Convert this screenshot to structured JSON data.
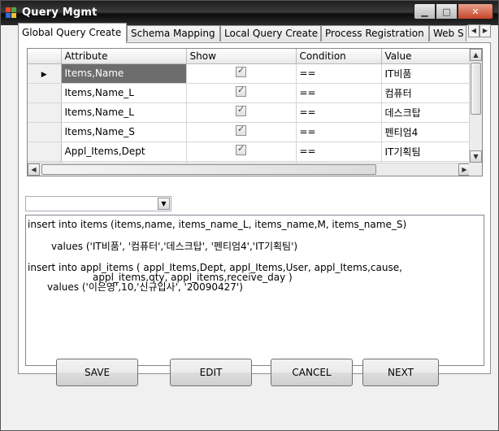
{
  "window": {
    "title": "Query Mgmt"
  },
  "tabs": [
    {
      "label": "Global Query Create",
      "active": true
    },
    {
      "label": "Schema Mapping",
      "active": false
    },
    {
      "label": "Local Query Create",
      "active": false
    },
    {
      "label": "Process Registration",
      "active": false
    },
    {
      "label": "Web S",
      "active": false
    }
  ],
  "grid": {
    "columns": [
      "Attribute",
      "Show",
      "Condition",
      "Value"
    ],
    "rows": [
      {
        "attribute": "Items,Name",
        "show": true,
        "condition": "==",
        "value": "IT비품",
        "current": true
      },
      {
        "attribute": "Items,Name_L",
        "show": true,
        "condition": "==",
        "value": "컴퓨터",
        "current": false
      },
      {
        "attribute": "Items,Name_L",
        "show": true,
        "condition": "==",
        "value": "데스크탑",
        "current": false
      },
      {
        "attribute": "Items,Name_S",
        "show": true,
        "condition": "==",
        "value": "펜티엄4",
        "current": false
      },
      {
        "attribute": "Appl_Items,Dept",
        "show": true,
        "condition": "==",
        "value": "IT기획팀",
        "current": false
      }
    ]
  },
  "combo": {
    "value": ""
  },
  "sql": {
    "line1": "insert into items (items,name, items_name_L, items_name,M, items_name_S)",
    "line2": "values ('IT비품', '컴퓨터','데스크탑', '펜티엄4','IT기획팀')",
    "line3": "insert into appl_items ( appl_Items,Dept, appl_Items,User, appl_Items,cause,",
    "line4": "appl_items,qty, appl_items,receive_day )",
    "line5": "values ('이은영',10,'신규입사', '20090427')"
  },
  "buttons": {
    "save": "SAVE",
    "edit": "EDIT",
    "cancel": "CANCEL",
    "next": "NEXT"
  }
}
